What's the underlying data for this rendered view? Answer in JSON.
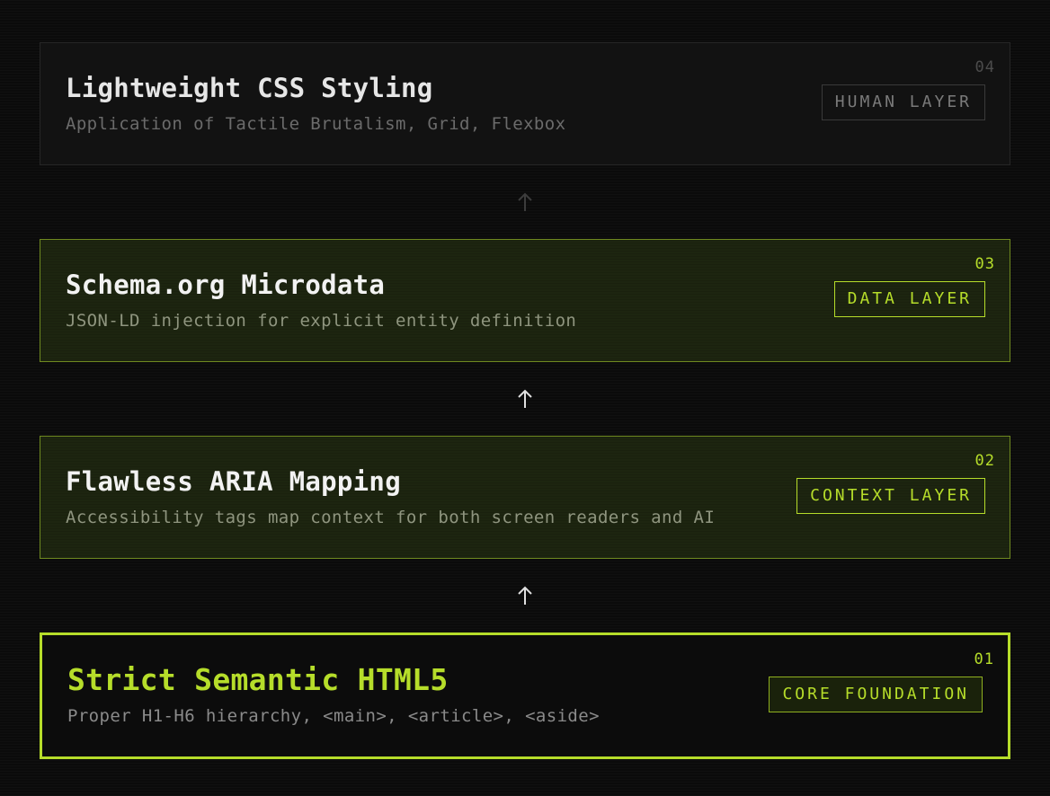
{
  "layers": [
    {
      "number": "04",
      "title": "Lightweight CSS Styling",
      "subtitle": "Application of Tactile Brutalism, Grid, Flexbox",
      "tag": "HUMAN LAYER"
    },
    {
      "number": "03",
      "title": "Schema.org Microdata",
      "subtitle": "JSON-LD injection for explicit entity definition",
      "tag": "DATA LAYER"
    },
    {
      "number": "02",
      "title": "Flawless ARIA Mapping",
      "subtitle": "Accessibility tags map context for both screen readers and AI",
      "tag": "CONTEXT LAYER"
    },
    {
      "number": "01",
      "title": "Strict Semantic HTML5",
      "subtitle": "Proper H1-H6 hierarchy, <main>, <article>, <aside>",
      "tag": "CORE FOUNDATION"
    }
  ],
  "colors": {
    "accent": "#b6dd2a",
    "background": "#0b0b0b",
    "muted_arrow": "#3c3c3c",
    "active_arrow": "#e0e0e0"
  },
  "icons": {
    "connector": "arrow-up-icon"
  }
}
